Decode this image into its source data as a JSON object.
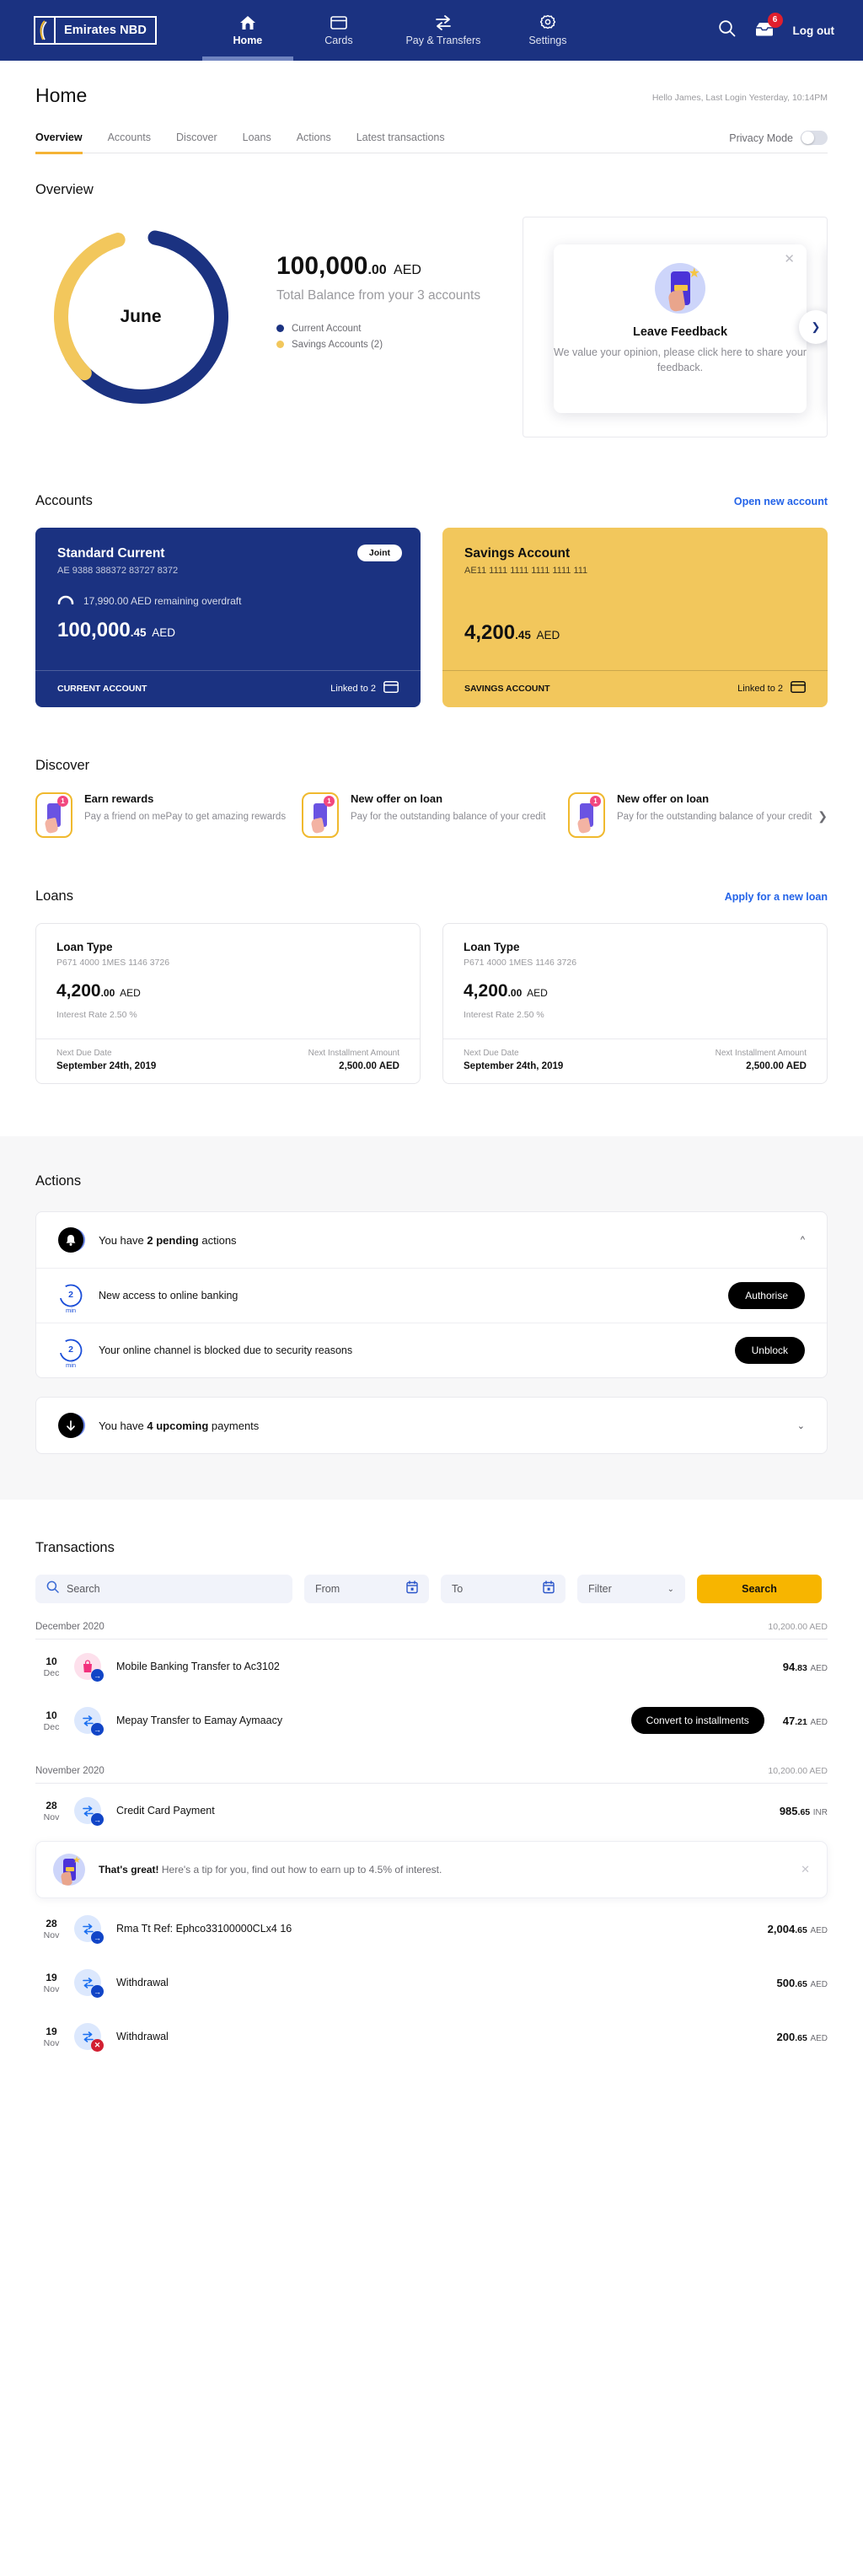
{
  "header": {
    "brand": "Emirates NBD",
    "nav": [
      {
        "label": "Home",
        "icon": "home-icon",
        "active": true
      },
      {
        "label": "Cards",
        "icon": "card-icon",
        "active": false
      },
      {
        "label": "Pay & Transfers",
        "icon": "transfer-icon",
        "active": false
      },
      {
        "label": "Settings",
        "icon": "gear-icon",
        "active": false
      }
    ],
    "search_icon": "search-icon",
    "inbox_icon": "inbox-icon",
    "inbox_badge": "6",
    "logout": "Log out"
  },
  "pagehead": {
    "title": "Home",
    "greeting": "Hello James, Last Login Yesterday, 10:14PM",
    "tabs": [
      {
        "label": "Overview",
        "active": true
      },
      {
        "label": "Accounts",
        "active": false
      },
      {
        "label": "Discover",
        "active": false
      },
      {
        "label": "Loans",
        "active": false
      },
      {
        "label": "Actions",
        "active": false
      },
      {
        "label": "Latest transactions",
        "active": false
      }
    ],
    "privacy_label": "Privacy Mode",
    "privacy_on": false
  },
  "overview": {
    "title": "Overview",
    "donut_center": "June",
    "balance_int": "100,000",
    "balance_dec": ".00",
    "balance_cur": "AED",
    "balance_sub": "Total Balance from your 3 accounts",
    "legend": [
      {
        "label": "Current Account",
        "color": "#1b3281"
      },
      {
        "label": "Savings Accounts (2)",
        "color": "#f2c75c"
      }
    ],
    "promo": {
      "title": "Leave Feedback",
      "sub": "We value your opinion, please click here to share your feedback.",
      "close_icon": "close-icon",
      "next_icon": "chevron-right-icon"
    }
  },
  "chart_data": {
    "type": "pie",
    "title": "Overview",
    "center_label": "June",
    "categories": [
      "Current Account",
      "Savings Accounts (2)"
    ],
    "values": [
      64,
      36
    ],
    "colors": [
      "#1b3281",
      "#f2c75c"
    ],
    "total_label": "100,000.00 AED",
    "legend_position": "right"
  },
  "accounts": {
    "title": "Accounts",
    "link": "Open new account",
    "cards": [
      {
        "name": "Standard Current",
        "iban": "AE 9388 388372 83727 8372",
        "chip": "Joint",
        "overdraft": "17,990.00 AED remaining overdraft",
        "amount_int": "100,000",
        "amount_dec": ".45",
        "amount_cur": "AED",
        "footer_type": "CURRENT ACCOUNT",
        "footer_linked": "Linked to 2",
        "theme": "navy"
      },
      {
        "name": "Savings Account",
        "iban": "AE11 1111 1111 1111 1111 111",
        "chip": "",
        "overdraft": "",
        "amount_int": "4,200",
        "amount_dec": ".45",
        "amount_cur": "AED",
        "footer_type": "SAVINGS ACCOUNT",
        "footer_linked": "Linked to 2",
        "theme": "gold"
      }
    ]
  },
  "discover": {
    "title": "Discover",
    "items": [
      {
        "title": "Earn rewards",
        "sub": "Pay a friend on mePay to get amazing rewards",
        "badge": "1"
      },
      {
        "title": "New offer on loan",
        "sub": "Pay for the outstanding balance of your credit",
        "badge": "1"
      },
      {
        "title": "New offer on loan",
        "sub": "Pay for the outstanding balance of your credit",
        "badge": "1"
      }
    ],
    "next_icon": "chevron-right-icon"
  },
  "loans": {
    "title": "Loans",
    "link": "Apply for a new loan",
    "cards": [
      {
        "type": "Loan Type",
        "ref": "P671 4000 1MES 1146 3726",
        "amount_int": "4,200",
        "amount_dec": ".00",
        "amount_cur": "AED",
        "rate": "Interest Rate 2.50 %",
        "due_caption": "Next Due Date",
        "due_value": "September 24th, 2019",
        "inst_caption": "Next Installment Amount",
        "inst_value": "2,500.00 AED"
      },
      {
        "type": "Loan Type",
        "ref": "P671 4000 1MES 1146 3726",
        "amount_int": "4,200",
        "amount_dec": ".00",
        "amount_cur": "AED",
        "rate": "Interest Rate 2.50 %",
        "due_caption": "Next Due Date",
        "due_value": "September 24th, 2019",
        "inst_caption": "Next Installment Amount",
        "inst_value": "2,500.00 AED"
      }
    ]
  },
  "actions": {
    "title": "Actions",
    "pending": {
      "pre": "You have ",
      "strong": "2 pending",
      "post": " actions",
      "icon": "bell-icon",
      "chevron": "chevron-up-icon",
      "rows": [
        {
          "timer": "2",
          "unit": "min",
          "text": "New access to online banking",
          "button": "Authorise"
        },
        {
          "timer": "2",
          "unit": "min",
          "text": "Your online channel is blocked due to security reasons",
          "button": "Unblock"
        }
      ]
    },
    "upcoming": {
      "pre": "You have ",
      "strong": "4 upcoming",
      "post": " payments",
      "icon": "arrow-down-icon",
      "chevron": "chevron-down-icon"
    }
  },
  "transactions": {
    "title": "Transactions",
    "search_placeholder": "Search",
    "search_icon": "search-icon",
    "from_label": "From",
    "to_label": "To",
    "calendar_icon": "calendar-icon",
    "filter_label": "Filter",
    "filter_chevron": "chevron-down-icon",
    "search_button": "Search",
    "groups": [
      {
        "month": "December 2020",
        "total": "10,200.00 AED",
        "rows": [
          {
            "day": "10",
            "mon": "Dec",
            "icon": "shopping-bag-icon",
            "icon_bg": "pink",
            "status": "ok",
            "desc": "Mobile Banking Transfer to Ac3102",
            "action": "",
            "amt_int": "94",
            "amt_dec": ".83",
            "amt_cur": "AED"
          },
          {
            "day": "10",
            "mon": "Dec",
            "icon": "transfer-icon",
            "icon_bg": "blue",
            "status": "ok",
            "desc": "Mepay Transfer to Eamay Aymaacy",
            "action": "Convert to installments",
            "amt_int": "47",
            "amt_dec": ".21",
            "amt_cur": "AED"
          }
        ]
      },
      {
        "month": "November 2020",
        "total": "10,200.00 AED",
        "rows": [
          {
            "day": "28",
            "mon": "Nov",
            "icon": "transfer-icon",
            "icon_bg": "blue",
            "status": "ok",
            "desc": "Credit Card Payment",
            "action": "",
            "amt_int": "985",
            "amt_dec": ".65",
            "amt_cur": "INR"
          },
          {
            "day": "28",
            "mon": "Nov",
            "icon": "transfer-icon",
            "icon_bg": "blue",
            "status": "ok",
            "desc": "Rma Tt Ref: Ephco33100000CLx4 16",
            "action": "",
            "amt_int": "2,004",
            "amt_dec": ".65",
            "amt_cur": "AED"
          },
          {
            "day": "19",
            "mon": "Nov",
            "icon": "transfer-icon",
            "icon_bg": "blue",
            "status": "ok",
            "desc": "Withdrawal",
            "action": "",
            "amt_int": "500",
            "amt_dec": ".65",
            "amt_cur": "AED"
          },
          {
            "day": "19",
            "mon": "Nov",
            "icon": "transfer-icon",
            "icon_bg": "blue",
            "status": "err",
            "desc": "Withdrawal",
            "action": "",
            "amt_int": "200",
            "amt_dec": ".65",
            "amt_cur": "AED"
          }
        ]
      }
    ],
    "tip": {
      "strong": "That's great!",
      "text": " Here's a tip for you, find out how to earn up to 4.5% of interest.",
      "close_icon": "close-icon"
    }
  },
  "colors": {
    "brand_navy": "#1b3281",
    "brand_gold": "#f2c75c",
    "accent_yellow": "#f7b500",
    "link_blue": "#2363e8",
    "danger_red": "#d21f31"
  }
}
